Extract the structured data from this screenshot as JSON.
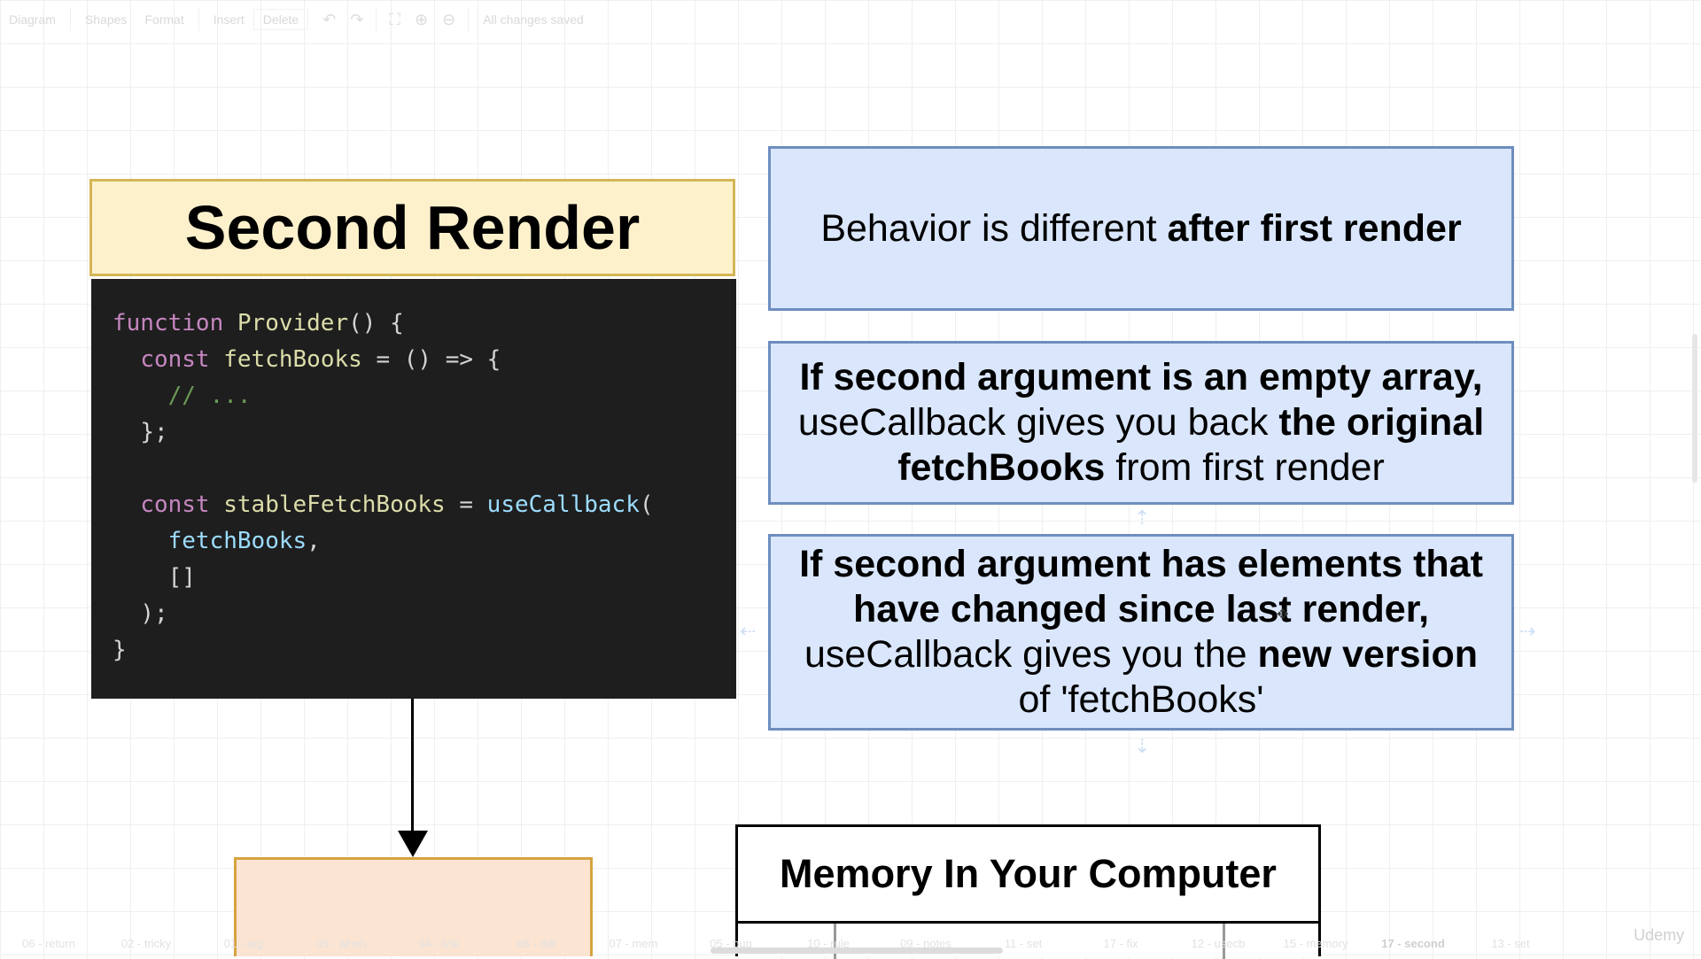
{
  "toolbar": {
    "diagram_menu": "Diagram",
    "shapes": "Shapes",
    "format": "Format",
    "insert": "Insert",
    "delete": "Delete",
    "status": "All changes saved"
  },
  "title": "Second Render",
  "code": {
    "line1_kw": "function",
    "line1_fn": "Provider",
    "line1_rest": "() {",
    "line2_kw": "const",
    "line2_var": "fetchBooks",
    "line2_rest": " = () => {",
    "line3_comment": "// ...",
    "line4": "};",
    "line6_kw": "const",
    "line6_var": "stableFetchBooks",
    "line6_eq": " = ",
    "line6_fn": "useCallback",
    "line6_paren": "(",
    "line7_var": "fetchBooks",
    "line7_comma": ",",
    "line8": "[]",
    "line9": ");",
    "line10": "}"
  },
  "box1": {
    "text_plain": "Behavior is different ",
    "text_bold": "after first render"
  },
  "box2": {
    "bold1": "If second argument is an empty array,",
    "plain1": "useCallback gives you back ",
    "bold2": "the original",
    "bold3": "fetchBooks",
    "plain2": " from first render"
  },
  "box3": {
    "bold1": "If second argument has elements that have changed since last render,",
    "plain1": " useCallback gives you the ",
    "bold2": "new version",
    "plain2": " of 'fetchBooks'"
  },
  "memory_box_title": "Memory In Your Computer",
  "page_tabs": [
    "06 - return",
    "02 - tricky",
    "01 - arg",
    "03 - when",
    "04 - link",
    "08 - diff",
    "07 - mem",
    "05 - bug",
    "10 - rule",
    "09 - notes",
    "11 - set",
    "17 - fix",
    "12 - usecb",
    "15 - memory",
    "17 - second",
    "13 - set"
  ],
  "active_tab_index": 14,
  "watermark": "Udemy",
  "colors": {
    "title_fill": "#fdf1cc",
    "title_border": "#d4b656",
    "code_bg": "#1e1e1e",
    "blue_fill": "#dae6fb",
    "blue_border": "#6d8ebf",
    "orange_fill": "#fbe4d2"
  }
}
